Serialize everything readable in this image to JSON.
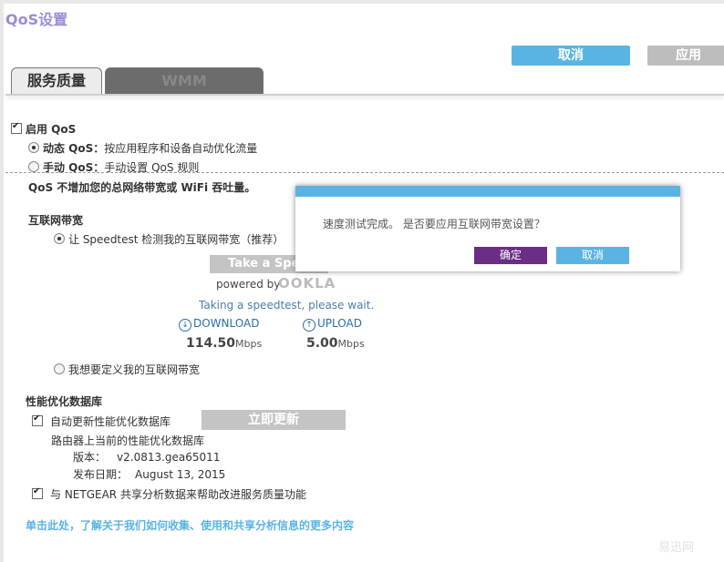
{
  "page": {
    "title": "QoS设置",
    "watermark": "易迅网"
  },
  "toolbar": {
    "cancel_label": "取消",
    "apply_label": "应用"
  },
  "tabs": [
    {
      "label": "服务质量"
    },
    {
      "label": "WMM"
    }
  ],
  "qos": {
    "enable_label": "启用 QoS",
    "dynamic_bold": "动态 QoS：",
    "dynamic_desc": "按应用程序和设备自动优化流量",
    "manual_bold": "手动 QoS：",
    "manual_desc": "手动设置 QoS 规则",
    "note": "QoS 不增加您的总网络带宽或 WiFi 吞吐量。"
  },
  "bandwidth": {
    "heading": "互联网带宽",
    "speedtest_option": "让 Speedtest 检测我的互联网带宽（推荐）",
    "speedtest_button": "Take a Spe",
    "powered_by": "powered by",
    "brand": "OOKLA",
    "status": "Taking a speedtest, please wait.",
    "download_label": "DOWNLOAD",
    "upload_label": "UPLOAD",
    "download_value": "114.50",
    "upload_value": "5.00",
    "unit": "Mbps",
    "custom_option": "我想要定义我的互联网带宽"
  },
  "database": {
    "heading": "性能优化数据库",
    "auto_update_label": "自动更新性能优化数据库",
    "update_button": "立即更新",
    "current_label": "路由器上当前的性能优化数据库",
    "version_label": "版本：",
    "version_value": "v2.0813.gea65011",
    "date_label": "发布日期：",
    "date_value": "August 13, 2015",
    "share_label": "与 NETGEAR 共享分析数据来帮助改进服务质量功能"
  },
  "link_text": "单击此处，了解关于我们如何收集、使用和共享分析信息的更多内容",
  "dialog": {
    "message": "速度测试完成。 是否要应用互联网带宽设置？",
    "ok_label": "确定",
    "cancel_label": "取消"
  },
  "colors": {
    "accent_blue": "#5ab4e2",
    "title_purple": "#9b8ad6",
    "ok_purple": "#6b2d85"
  },
  "icons": {
    "download": "arrow-down-circle-icon",
    "upload": "arrow-up-circle-icon"
  }
}
